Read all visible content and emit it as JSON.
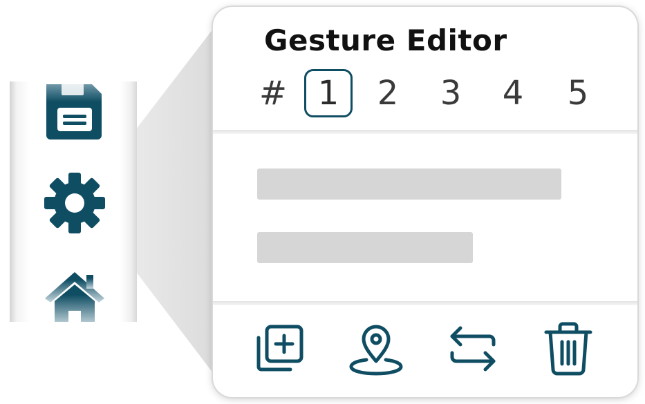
{
  "colors": {
    "accent": "#0f4d63",
    "placeholder": "#d6d6d6",
    "text": "#111111"
  },
  "sidebar": {
    "items": [
      {
        "icon": "save-icon"
      },
      {
        "icon": "gear-icon"
      },
      {
        "icon": "home-icon"
      }
    ]
  },
  "editor": {
    "title": "Gesture Editor",
    "tabs_prefix": "#",
    "tabs": [
      {
        "label": "1",
        "active": true
      },
      {
        "label": "2",
        "active": false
      },
      {
        "label": "3",
        "active": false
      },
      {
        "label": "4",
        "active": false
      },
      {
        "label": "5",
        "active": false
      }
    ],
    "toolbar": [
      {
        "icon": "add-copy-icon"
      },
      {
        "icon": "location-pin-icon"
      },
      {
        "icon": "swap-arrows-icon"
      },
      {
        "icon": "trash-icon"
      }
    ]
  }
}
